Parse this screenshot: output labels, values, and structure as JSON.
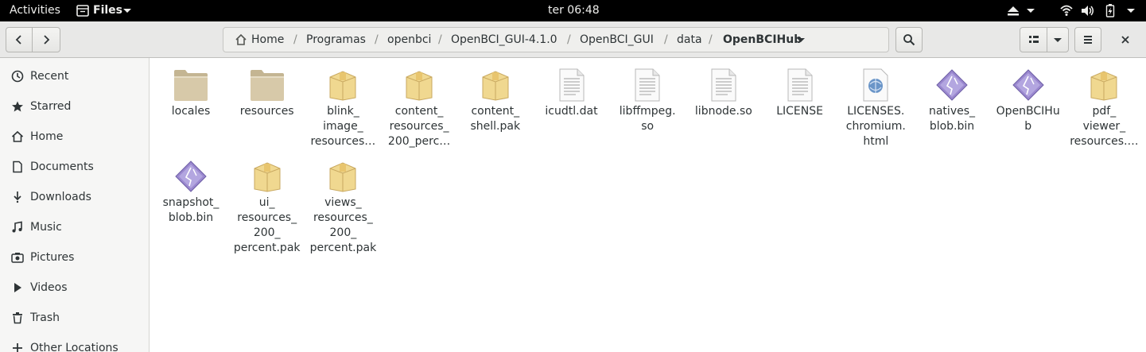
{
  "topbar": {
    "activities": "Activities",
    "app_menu": "Files",
    "clock": "ter 06:48"
  },
  "toolbar": {
    "breadcrumbs": [
      "Home",
      "Programas",
      "openbci",
      "OpenBCI_GUI-4.1.0",
      "OpenBCI_GUI",
      "data",
      "OpenBCIHub"
    ],
    "separator": "/"
  },
  "sidebar": {
    "items": [
      {
        "label": "Recent",
        "icon": "clock-icon"
      },
      {
        "label": "Starred",
        "icon": "star-icon"
      },
      {
        "label": "Home",
        "icon": "home-icon"
      },
      {
        "label": "Documents",
        "icon": "document-icon"
      },
      {
        "label": "Downloads",
        "icon": "download-icon"
      },
      {
        "label": "Music",
        "icon": "music-icon"
      },
      {
        "label": "Pictures",
        "icon": "camera-icon"
      },
      {
        "label": "Videos",
        "icon": "video-icon"
      },
      {
        "label": "Trash",
        "icon": "trash-icon"
      },
      {
        "label": "Other Locations",
        "icon": "plus-icon"
      }
    ]
  },
  "files": [
    {
      "name": "locales",
      "type": "folder"
    },
    {
      "name": "resources",
      "type": "folder"
    },
    {
      "name": "blink_\nimage_\nresources…",
      "type": "package"
    },
    {
      "name": "content_\nresources_\n200_perc…",
      "type": "package"
    },
    {
      "name": "content_\nshell.pak",
      "type": "package"
    },
    {
      "name": "icudtl.dat",
      "type": "text"
    },
    {
      "name": "libffmpeg.\nso",
      "type": "text"
    },
    {
      "name": "libnode.so",
      "type": "text"
    },
    {
      "name": "LICENSE",
      "type": "text"
    },
    {
      "name": "LICENSES.\nchromium.\nhtml",
      "type": "html"
    },
    {
      "name": "natives_\nblob.bin",
      "type": "binary"
    },
    {
      "name": "OpenBCIHu\nb",
      "type": "binary"
    },
    {
      "name": "pdf_\nviewer_\nresources.…",
      "type": "package"
    },
    {
      "name": "snapshot_\nblob.bin",
      "type": "binary"
    },
    {
      "name": "ui_\nresources_\n200_\npercent.pak",
      "type": "package"
    },
    {
      "name": "views_\nresources_\n200_\npercent.pak",
      "type": "package"
    }
  ],
  "colors": {
    "folder": "#d7c9a9",
    "package": "#f0d890",
    "binary": "#9a88cf",
    "topbar": "#000000",
    "headerbar": "#e8e8e7"
  }
}
